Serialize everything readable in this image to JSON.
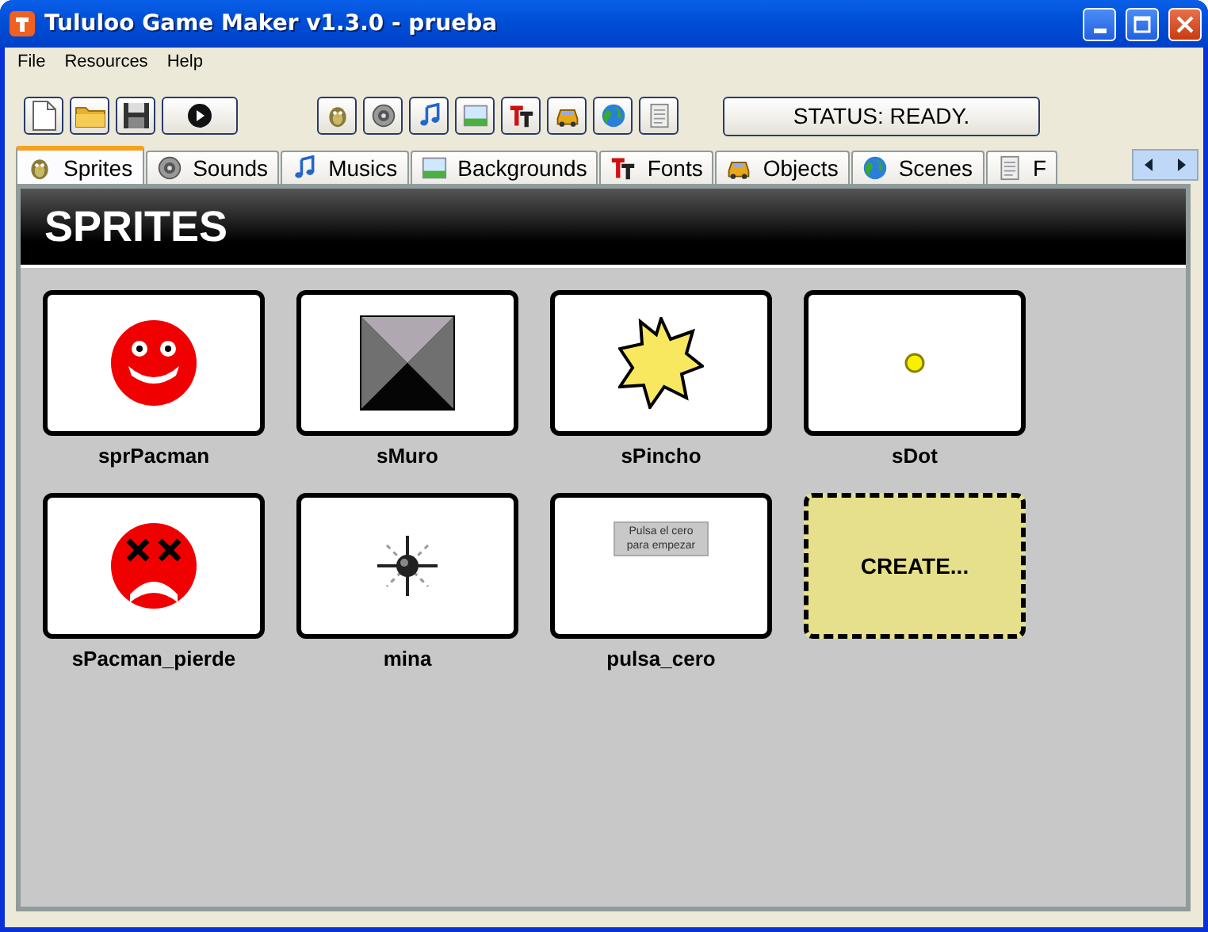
{
  "window": {
    "title": "Tululoo Game Maker v1.3.0 - prueba"
  },
  "menu": [
    "File",
    "Resources",
    "Help"
  ],
  "toolbar": {
    "file_buttons": [
      {
        "kind": "new"
      },
      {
        "kind": "open"
      },
      {
        "kind": "save"
      },
      {
        "kind": "play"
      }
    ],
    "resource_buttons": [
      {
        "kind": "sprite"
      },
      {
        "kind": "sound"
      },
      {
        "kind": "music"
      },
      {
        "kind": "background"
      },
      {
        "kind": "font"
      },
      {
        "kind": "object"
      },
      {
        "kind": "scene"
      },
      {
        "kind": "script"
      }
    ],
    "status": "STATUS: READY."
  },
  "tabs": [
    {
      "label": "Sprites",
      "kind": "sprite",
      "selected": true
    },
    {
      "label": "Sounds",
      "kind": "sound",
      "selected": false
    },
    {
      "label": "Musics",
      "kind": "music",
      "selected": false
    },
    {
      "label": "Backgrounds",
      "kind": "background",
      "selected": false
    },
    {
      "label": "Fonts",
      "kind": "font",
      "selected": false
    },
    {
      "label": "Objects",
      "kind": "object",
      "selected": false
    },
    {
      "label": "Scenes",
      "kind": "scene",
      "selected": false
    },
    {
      "label": "F",
      "kind": "script",
      "selected": false
    }
  ],
  "panel": {
    "heading": "SPRITES",
    "items": [
      {
        "kind": "smiley",
        "name": "sprPacman"
      },
      {
        "kind": "wall",
        "name": "sMuro"
      },
      {
        "kind": "star",
        "name": "sPincho"
      },
      {
        "kind": "dot",
        "name": "sDot"
      },
      {
        "kind": "sad",
        "name": "sPacman_pierde"
      },
      {
        "kind": "mine",
        "name": "mina"
      },
      {
        "kind": "sign",
        "name": "pulsa_cero",
        "sign_text": "Pulsa el cero para empezar"
      },
      {
        "kind": "create",
        "name": "CREATE..."
      }
    ]
  }
}
